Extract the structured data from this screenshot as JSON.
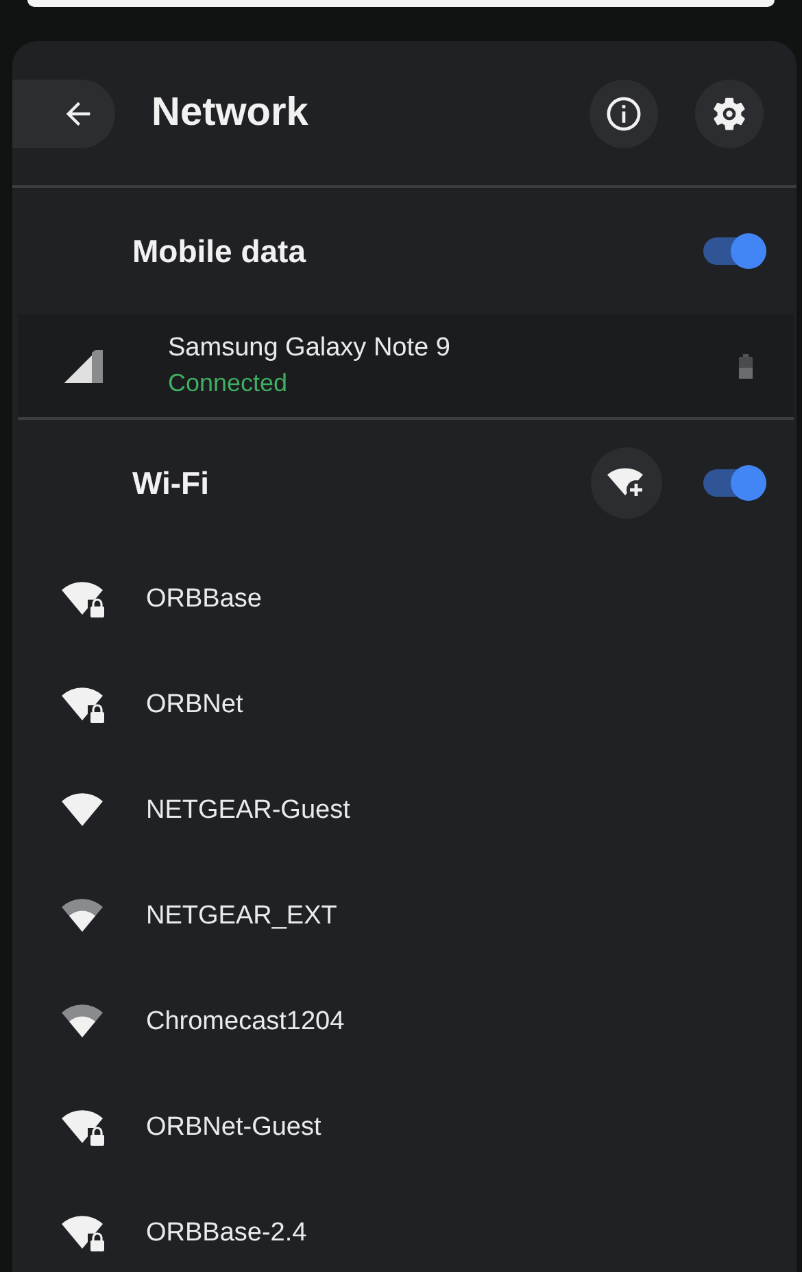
{
  "header": {
    "title": "Network"
  },
  "mobile_data": {
    "label": "Mobile data",
    "on": true,
    "device": {
      "name": "Samsung Galaxy Note 9",
      "status": "Connected"
    }
  },
  "wifi": {
    "label": "Wi-Fi",
    "on": true,
    "networks": [
      {
        "name": "ORBBase",
        "secured": true,
        "kind": "full"
      },
      {
        "name": "ORBNet",
        "secured": true,
        "kind": "full"
      },
      {
        "name": "NETGEAR-Guest",
        "secured": false,
        "kind": "full"
      },
      {
        "name": "NETGEAR_EXT",
        "secured": false,
        "kind": "partial"
      },
      {
        "name": "Chromecast1204",
        "secured": false,
        "kind": "partial"
      },
      {
        "name": "ORBNet-Guest",
        "secured": true,
        "kind": "full"
      },
      {
        "name": "ORBBase-2.4",
        "secured": true,
        "kind": "full"
      }
    ]
  }
}
